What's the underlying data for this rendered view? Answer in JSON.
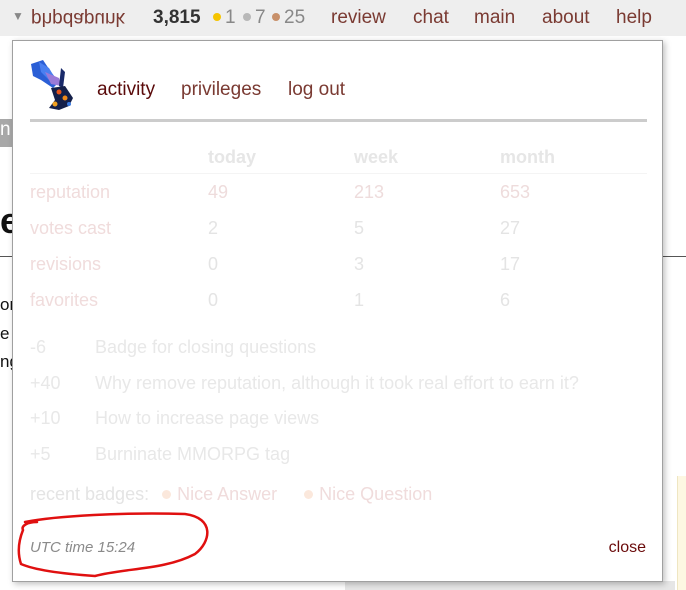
{
  "topbar": {
    "username": "phpdapunk",
    "reputation": "3,815",
    "badges": [
      {
        "type": "gold",
        "count": "1",
        "color": "#f5c400"
      },
      {
        "type": "silver",
        "count": "7",
        "color": "#b8b8b8"
      },
      {
        "type": "bronze",
        "count": "25",
        "color": "#c8906a"
      }
    ],
    "nav": [
      "review",
      "chat",
      "main",
      "about",
      "help"
    ]
  },
  "background": {
    "gray_fragment": "n",
    "big_fragment": "e",
    "text_fragments": [
      "on",
      "e",
      "ng"
    ]
  },
  "popup": {
    "tabs": [
      {
        "label": "activity",
        "active": true
      },
      {
        "label": "privileges",
        "active": false
      },
      {
        "label": "log out",
        "active": false
      }
    ],
    "stats": {
      "headers": [
        "",
        "today",
        "week",
        "month"
      ],
      "rows": [
        {
          "label": "reputation",
          "today": "49",
          "week": "213",
          "month": "653"
        },
        {
          "label": "votes cast",
          "today": "2",
          "week": "5",
          "month": "27"
        },
        {
          "label": "revisions",
          "today": "0",
          "week": "3",
          "month": "17"
        },
        {
          "label": "favorites",
          "today": "0",
          "week": "1",
          "month": "6"
        }
      ]
    },
    "reputation_changes": [
      {
        "amount": "-6",
        "title": "Badge for closing questions"
      },
      {
        "amount": "+40",
        "title": "Why remove reputation, although it took real effort to earn it?"
      },
      {
        "amount": "+10",
        "title": "How to increase page views"
      },
      {
        "amount": "+5",
        "title": "Burninate MMORPG tag"
      }
    ],
    "recent_badges": {
      "label": "recent badges:",
      "items": [
        "Nice Answer",
        "Nice Question"
      ]
    },
    "utc_time": "UTC time 15:24",
    "close_label": "close"
  },
  "annotation": {
    "color": "#e01010",
    "description": "hand-drawn circle around UTC time"
  }
}
